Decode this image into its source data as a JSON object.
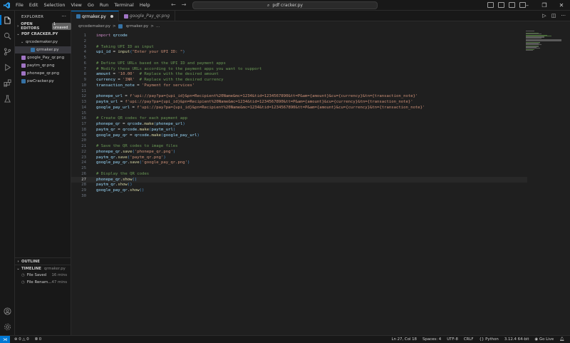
{
  "titlebar": {
    "menu": [
      "File",
      "Edit",
      "Selection",
      "View",
      "Go",
      "Run",
      "Terminal",
      "Help"
    ],
    "search_text": "pdf cracker.py"
  },
  "sidebar": {
    "title": "EXPLORER",
    "open_editors": {
      "label": "OPEN EDITORS",
      "badge": "1 unsaved"
    },
    "folder": "PDF CRACKER.PY",
    "files": [
      {
        "name": "qrcodemaker.py",
        "type": "folder"
      },
      {
        "name": "qrmaker.py",
        "type": "py",
        "selected": true
      },
      {
        "name": "google_Pay_qr.png",
        "type": "png"
      },
      {
        "name": "paytm_qr.png",
        "type": "png"
      },
      {
        "name": "phonepe_qr.png",
        "type": "png"
      },
      {
        "name": "pwCracker.py",
        "type": "py"
      }
    ],
    "outline_label": "OUTLINE",
    "timeline_label": "TIMELINE",
    "timeline_file": "qrmaker.py",
    "timeline": [
      {
        "label": "File Saved",
        "ago": "16 mins"
      },
      {
        "label": "File Renam...",
        "ago": "47 mins"
      }
    ]
  },
  "tabs": [
    {
      "label": "qrmaker.py",
      "active": true,
      "dirty": true
    },
    {
      "label": "google_Pay_qr.png",
      "active": false,
      "dirty": false
    }
  ],
  "breadcrumb": [
    "qrcodemaker.py",
    ">",
    "qrmaker.py",
    ">",
    "..."
  ],
  "editor": {
    "current_line": 27,
    "lines": [
      {
        "n": "1",
        "t": "import qrcode"
      },
      {
        "n": "2",
        "t": ""
      },
      {
        "n": "3",
        "t": "# Taking UPI ID as input"
      },
      {
        "n": "4",
        "t": "upi_id = input(\"Enter your UPI ID: \")"
      },
      {
        "n": "5",
        "t": ""
      },
      {
        "n": "6",
        "t": "# Define UPI URLs based on the UPI ID and payment apps"
      },
      {
        "n": "7",
        "t": "# Modify these URLs according to the payment apps you want to support"
      },
      {
        "n": "8",
        "t": "amount = '10.00'  # Replace with the desired amount"
      },
      {
        "n": "9",
        "t": "currency = 'INR'  # Replace with the desired currency"
      },
      {
        "n": "10",
        "t": "transaction_note = 'Payment for services'"
      },
      {
        "n": "11",
        "t": ""
      },
      {
        "n": "12",
        "t": "phonepe_url = f'upi://pay?pa={upi_id}&pn=Recipient%20Name&mc=1234&tid=1234567890&tt=P&am={amount}&cu={currency}&tn={transaction_note}'"
      },
      {
        "n": "13",
        "t": "paytm_url = f'upi://pay?pa={upi_id}&pn=Recipient%20Name&mc=1234&tid=1234567890&tt=P&am={amount}&cu={currency}&tn={transaction_note}'"
      },
      {
        "n": "14",
        "t": "google_pay_url = f'upi://pay?pa={upi_id}&pn=Recipient%20Name&mc=1234&tid=1234567890&tt=P&am={amount}&cu={currency}&tn={transaction_note}'"
      },
      {
        "n": "15",
        "t": ""
      },
      {
        "n": "16",
        "t": "# Create QR codes for each payment app"
      },
      {
        "n": "17",
        "t": "phonepe_qr = qrcode.make(phonepe_url)"
      },
      {
        "n": "18",
        "t": "paytm_qr = qrcode.make(paytm_url)"
      },
      {
        "n": "19",
        "t": "google_pay_qr = qrcode.make(google_pay_url)"
      },
      {
        "n": "20",
        "t": ""
      },
      {
        "n": "21",
        "t": "# Save the QR codes to image files"
      },
      {
        "n": "22",
        "t": "phonepe_qr.save('phonepe_qr.png')"
      },
      {
        "n": "23",
        "t": "paytm_qr.save('paytm_qr.png')"
      },
      {
        "n": "24",
        "t": "google_pay_qr.save('google_pay_qr.png')"
      },
      {
        "n": "25",
        "t": ""
      },
      {
        "n": "26",
        "t": "# Display the QR codes"
      },
      {
        "n": "27",
        "t": "phonepe_qr.show()"
      },
      {
        "n": "28",
        "t": "paytm_qr.show()"
      },
      {
        "n": "29",
        "t": "google_pay_qr.show()"
      },
      {
        "n": "30",
        "t": ""
      }
    ]
  },
  "statusbar": {
    "errors": "0",
    "warnings": "0",
    "ports": "0",
    "position": "Ln 27, Col 18",
    "spaces": "Spaces: 4",
    "encoding": "UTF-8",
    "eol": "CRLF",
    "language": "Python",
    "interpreter": "3.12.4 64-bit",
    "golive": "Go Live"
  },
  "colors": {
    "accent": "#0078d4",
    "keyword": "#c586c0",
    "comment": "#6a9955",
    "string": "#ce9178",
    "function": "#dcdcaa",
    "variable": "#9cdcfe"
  }
}
